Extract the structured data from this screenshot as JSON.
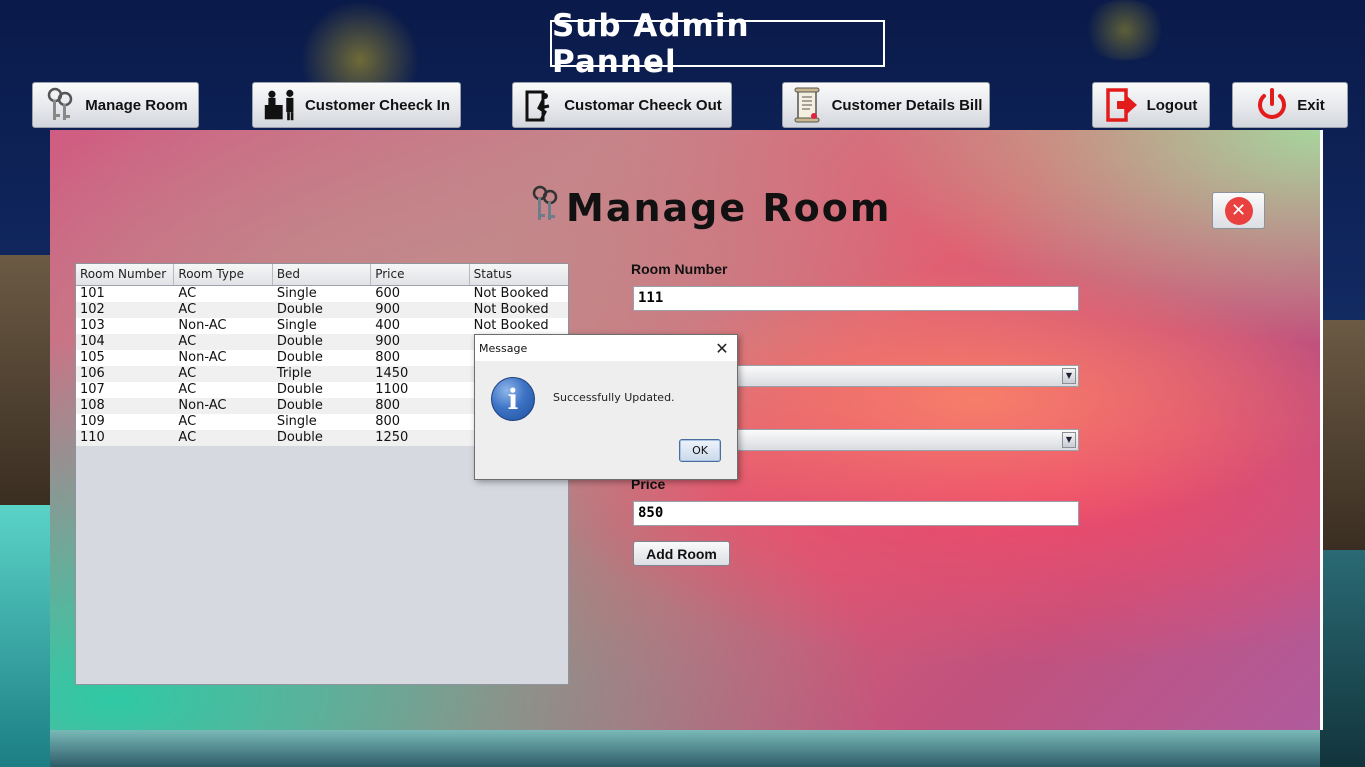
{
  "header": {
    "title": "Sub Admin Pannel"
  },
  "nav": {
    "manage_room": "Manage Room",
    "check_in": "Customer Cheeck In",
    "check_out": "Customar Cheeck Out",
    "details_bill": "Customer Details Bill",
    "logout": "Logout",
    "exit": "Exit"
  },
  "panel": {
    "title": "Manage Room",
    "table": {
      "columns": [
        "Room Number",
        "Room Type",
        "Bed",
        "Price",
        "Status"
      ],
      "rows": [
        [
          "101",
          "AC",
          "Single",
          "600",
          "Not Booked"
        ],
        [
          "102",
          "AC",
          "Double",
          "900",
          "Not Booked"
        ],
        [
          "103",
          "Non-AC",
          "Single",
          "400",
          "Not Booked"
        ],
        [
          "104",
          "AC",
          "Double",
          "900",
          ""
        ],
        [
          "105",
          "Non-AC",
          "Double",
          "800",
          ""
        ],
        [
          "106",
          "AC",
          "Triple",
          "1450",
          ""
        ],
        [
          "107",
          "AC",
          "Double",
          "1100",
          ""
        ],
        [
          "108",
          "Non-AC",
          "Double",
          "800",
          ""
        ],
        [
          "109",
          "AC",
          "Single",
          "800",
          ""
        ],
        [
          "110",
          "AC",
          "Double",
          "1250",
          ""
        ]
      ]
    },
    "form": {
      "room_number_label": "Room Number",
      "room_number_value": "111",
      "price_label": "Price",
      "price_value": "850",
      "add_button": "Add Room"
    }
  },
  "dialog": {
    "title": "Message",
    "message": "Successfully Updated.",
    "ok": "OK",
    "close_glyph": "✕",
    "icon_glyph": "i"
  },
  "colors": {
    "panel_accent": "#ef4a6a",
    "close_red": "#e8413f",
    "info_blue": "#3e74c6"
  }
}
